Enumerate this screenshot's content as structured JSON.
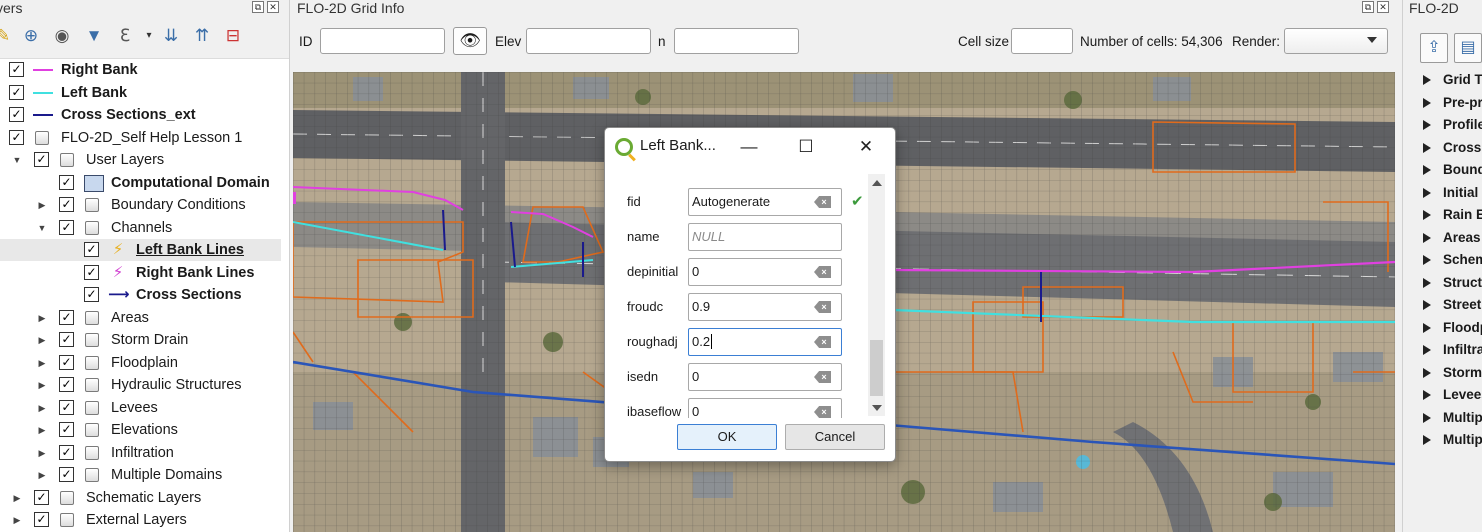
{
  "layers_panel": {
    "title": "yers",
    "items": [
      {
        "label": "Right Bank",
        "bold": true
      },
      {
        "label": "Left Bank",
        "bold": true
      },
      {
        "label": "Cross Sections_ext",
        "bold": true
      },
      {
        "label": "FLO-2D_Self Help Lesson 1",
        "bold": false
      },
      {
        "label": "User Layers",
        "bold": false
      },
      {
        "label": "Computational Domain",
        "bold": true
      },
      {
        "label": "Boundary Conditions",
        "bold": false
      },
      {
        "label": "Channels",
        "bold": false
      },
      {
        "label": "Left Bank Lines",
        "bold": true
      },
      {
        "label": "Right Bank Lines",
        "bold": true
      },
      {
        "label": "Cross Sections",
        "bold": true
      },
      {
        "label": "Areas",
        "bold": false
      },
      {
        "label": "Storm Drain",
        "bold": false
      },
      {
        "label": "Floodplain",
        "bold": false
      },
      {
        "label": "Hydraulic Structures",
        "bold": false
      },
      {
        "label": "Levees",
        "bold": false
      },
      {
        "label": "Elevations",
        "bold": false
      },
      {
        "label": "Infiltration",
        "bold": false
      },
      {
        "label": "Multiple Domains",
        "bold": false
      },
      {
        "label": "Schematic Layers",
        "bold": false
      },
      {
        "label": "External Layers",
        "bold": false
      }
    ],
    "colors": {
      "right_bank": "#e040e0",
      "left_bank": "#40e0e0",
      "cross_sections": "#1a1a8c"
    }
  },
  "grid_info": {
    "title": "FLO-2D Grid Info",
    "id_label": "ID",
    "elev_label": "Elev",
    "n_label": "n",
    "cell_size_label": "Cell size",
    "num_cells_text": "Number of cells: 54,306",
    "render_label": "Render:",
    "id_value": "",
    "elev_value": "",
    "n_value": "",
    "cell_size_value": "",
    "render_value": ""
  },
  "flo_panel": {
    "title": "FLO-2D",
    "items": [
      "Grid To",
      "Pre-pr",
      "Profile",
      "Cross S",
      "Bound",
      "Initial",
      "Rain E",
      "Areas",
      "Schem",
      "Structu",
      "Street",
      "Floodp",
      "Infiltra",
      "Storm",
      "Levees",
      "Multip",
      "Multip"
    ]
  },
  "dialog": {
    "title": "Left Bank...",
    "fields": [
      {
        "label": "fid",
        "value": "Autogenerate"
      },
      {
        "label": "name",
        "value": "NULL"
      },
      {
        "label": "depinitial",
        "value": "0"
      },
      {
        "label": "froudc",
        "value": "0.9"
      },
      {
        "label": "roughadj",
        "value": "0.2"
      },
      {
        "label": "isedn",
        "value": "0"
      },
      {
        "label": "ibaseflow",
        "value": "0"
      }
    ],
    "ok_label": "OK",
    "cancel_label": "Cancel"
  }
}
